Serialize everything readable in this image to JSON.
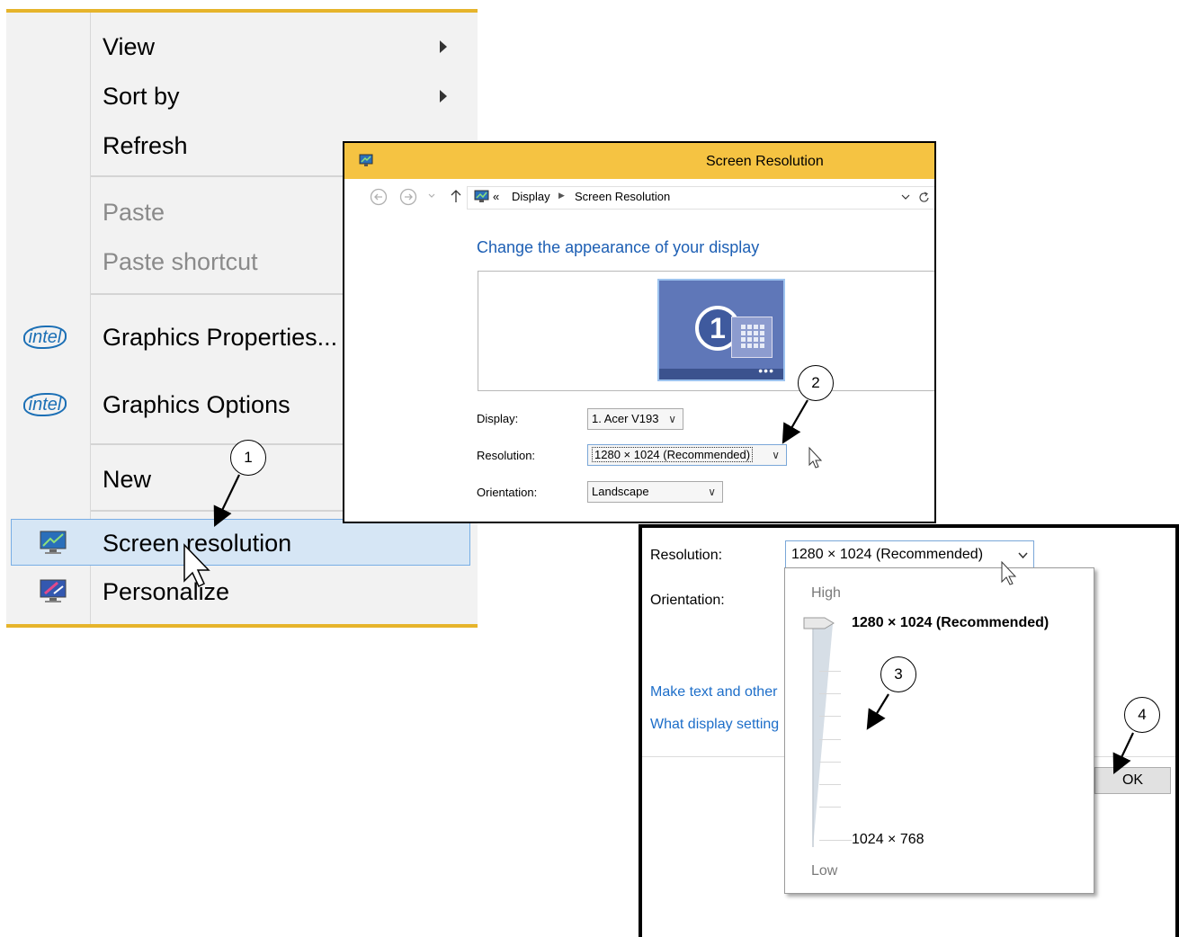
{
  "context_menu": {
    "items": {
      "view": "View",
      "sort_by": "Sort by",
      "refresh": "Refresh",
      "paste": "Paste",
      "paste_shortcut": "Paste shortcut",
      "graphics_properties": "Graphics Properties...",
      "graphics_options": "Graphics Options",
      "new": "New",
      "screen_resolution": "Screen resolution",
      "personalize": "Personalize"
    },
    "intel_logo_text": "intel"
  },
  "screen_resolution_window": {
    "title": "Screen Resolution",
    "breadcrumb": {
      "separator_prefix": "«",
      "display": "Display",
      "current": "Screen Resolution"
    },
    "heading": "Change the appearance of your display",
    "monitor_number": "1",
    "display_label": "Display:",
    "display_value": "1. Acer V193",
    "resolution_label": "Resolution:",
    "resolution_value": "1280 × 1024 (Recommended)",
    "orientation_label": "Orientation:",
    "orientation_value": "Landscape"
  },
  "zoom_window": {
    "resolution_label": "Resolution:",
    "resolution_value": "1280 × 1024 (Recommended)",
    "orientation_label": "Orientation:",
    "link_text_size": "Make text and other",
    "link_display_settings": "What display setting",
    "ok_label": "OK"
  },
  "resolution_dropdown": {
    "high_label": "High",
    "low_label": "Low",
    "top_option": "1280 × 1024 (Recommended)",
    "bottom_option": "1024 × 768",
    "slider_level": 1.0
  },
  "callouts": [
    "1",
    "2",
    "3",
    "4"
  ],
  "colors": {
    "menu_border": "#e6b42b",
    "title_bar": "#f5c342",
    "link_blue": "#1d6ec9",
    "selection": "#d6e6f5"
  }
}
